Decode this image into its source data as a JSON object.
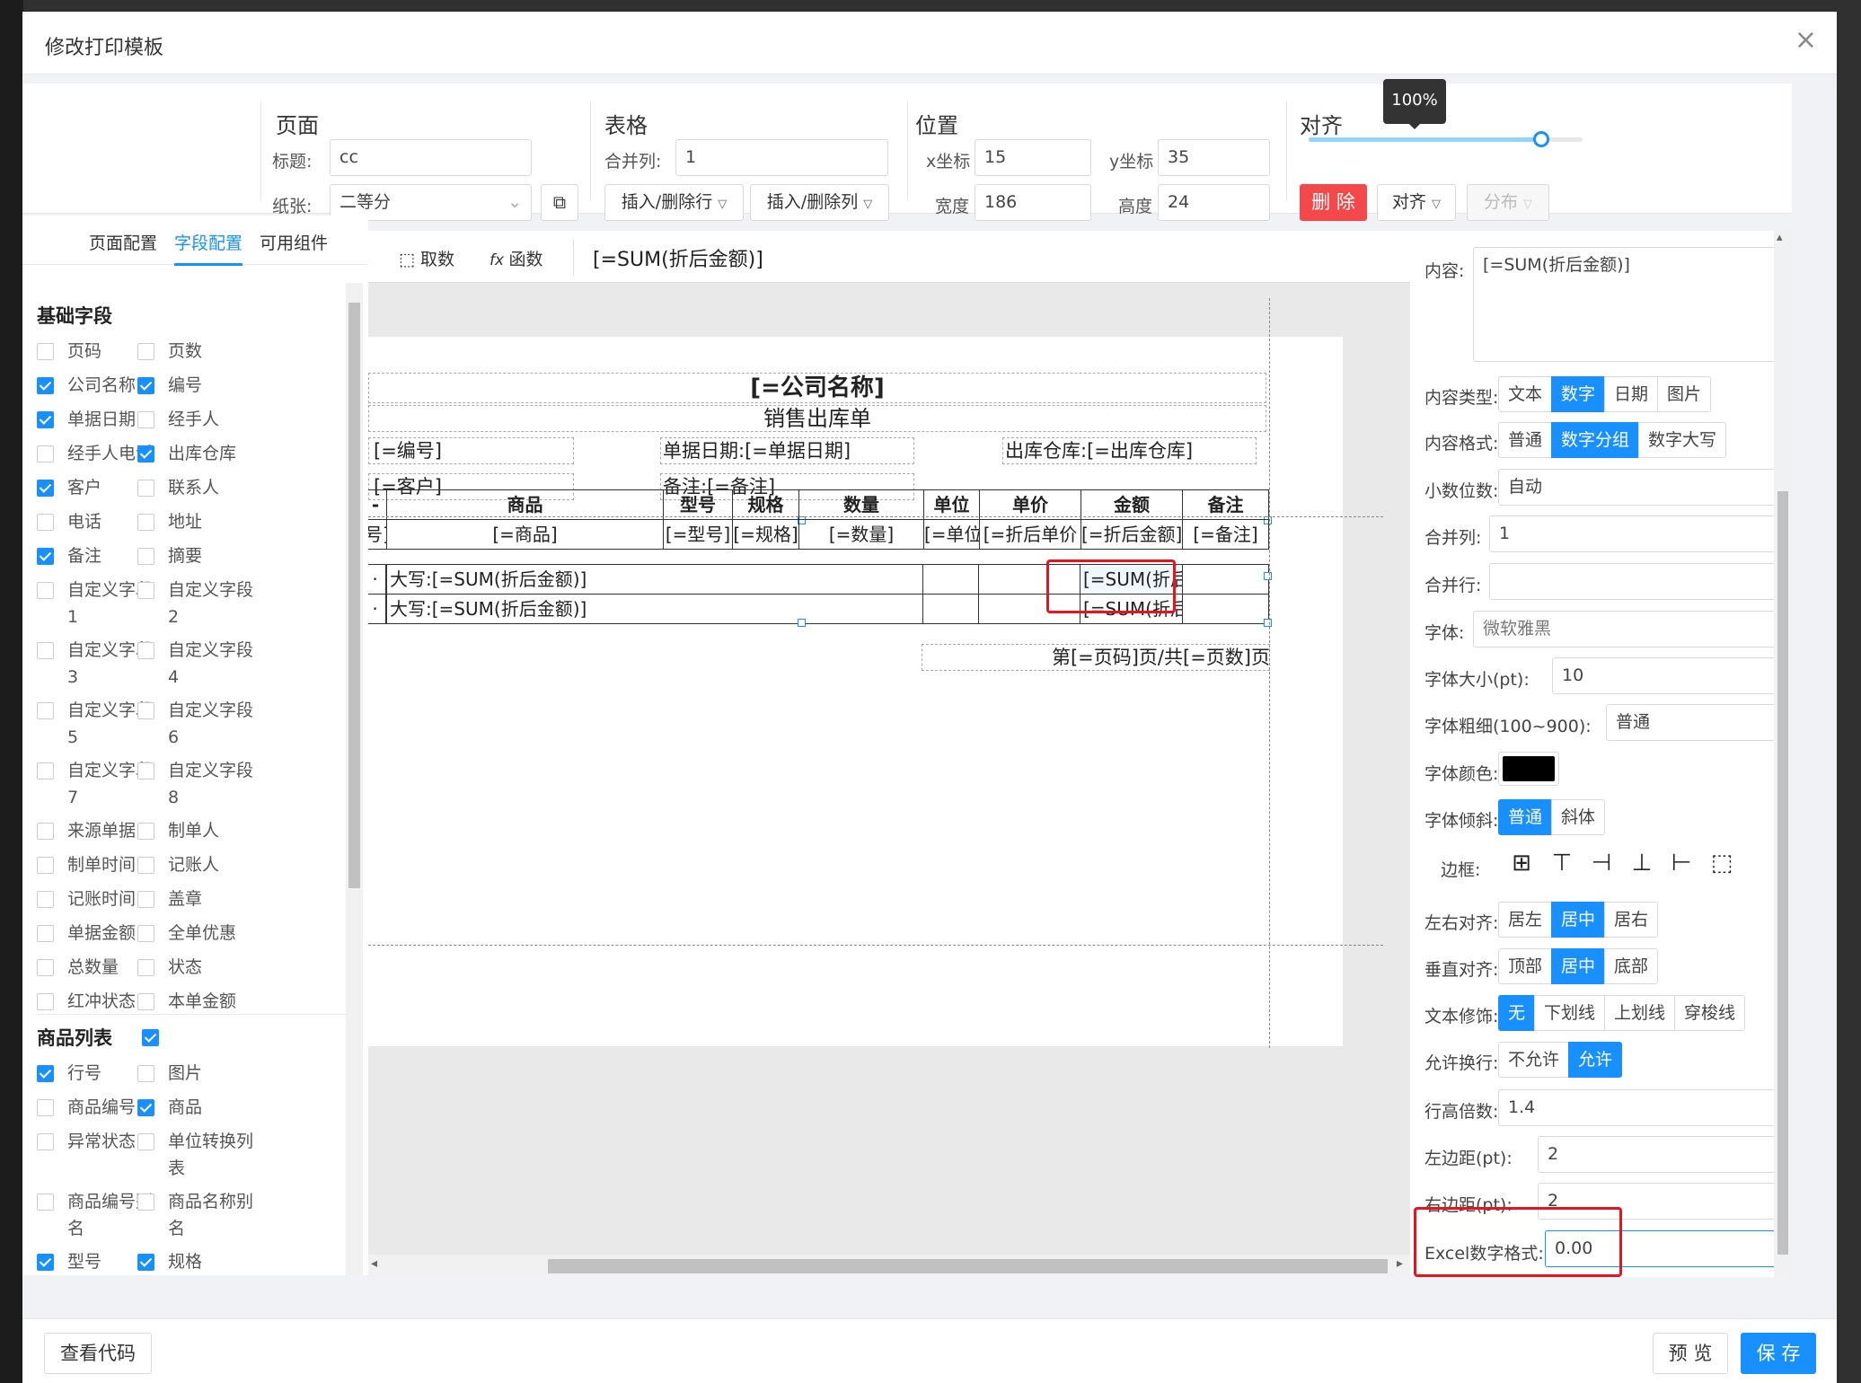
{
  "dialog": {
    "title": "修改打印模板",
    "close": "×",
    "footer": {
      "view_code": "查看代码",
      "preview": "预 览",
      "save": "保 存"
    }
  },
  "toolbar": {
    "page": {
      "title": "页面",
      "title_label": "标题:",
      "title_value": "cc",
      "paper_label": "纸张:",
      "paper_value": "二等分"
    },
    "table": {
      "title": "表格",
      "merge_col_label": "合并列:",
      "merge_col_value": "1",
      "row_btn": "插入/删除行",
      "col_btn": "插入/删除列"
    },
    "position": {
      "title": "位置",
      "x_label": "x坐标",
      "x_value": "15",
      "y_label": "y坐标",
      "y_value": "35",
      "w_label": "宽度",
      "w_value": "186",
      "h_label": "高度",
      "h_value": "24"
    },
    "align": {
      "title": "对齐",
      "zoom": "100%",
      "zoom_level": 0.85,
      "delete": "删 除",
      "align_btn": "对齐",
      "distribute_btn": "分布"
    }
  },
  "left": {
    "tabs": [
      "页面配置",
      "字段配置",
      "可用组件"
    ],
    "active_tab": 1,
    "basic_title": "基础字段",
    "basic_fields": [
      {
        "label": "页码",
        "checked": false
      },
      {
        "label": "页数",
        "checked": false
      },
      {
        "label": "公司名称",
        "checked": true
      },
      {
        "label": "编号",
        "checked": true
      },
      {
        "label": "单据日期",
        "checked": true
      },
      {
        "label": "经手人",
        "checked": false
      },
      {
        "label": "经手人电话",
        "checked": false
      },
      {
        "label": "出库仓库",
        "checked": true
      },
      {
        "label": "客户",
        "checked": true
      },
      {
        "label": "联系人",
        "checked": false
      },
      {
        "label": "电话",
        "checked": false
      },
      {
        "label": "地址",
        "checked": false
      },
      {
        "label": "备注",
        "checked": true
      },
      {
        "label": "摘要",
        "checked": false
      },
      {
        "label": "自定义字段1",
        "checked": false
      },
      {
        "label": "自定义字段2",
        "checked": false
      },
      {
        "label": "自定义字段3",
        "checked": false
      },
      {
        "label": "自定义字段4",
        "checked": false
      },
      {
        "label": "自定义字段5",
        "checked": false
      },
      {
        "label": "自定义字段6",
        "checked": false
      },
      {
        "label": "自定义字段7",
        "checked": false
      },
      {
        "label": "自定义字段8",
        "checked": false
      },
      {
        "label": "来源单据",
        "checked": false
      },
      {
        "label": "制单人",
        "checked": false
      },
      {
        "label": "制单时间",
        "checked": false
      },
      {
        "label": "记账人",
        "checked": false
      },
      {
        "label": "记账时间",
        "checked": false
      },
      {
        "label": "盖章",
        "checked": false
      },
      {
        "label": "单据金额",
        "checked": false
      },
      {
        "label": "全单优惠",
        "checked": false
      },
      {
        "label": "总数量",
        "checked": false
      },
      {
        "label": "状态",
        "checked": false
      },
      {
        "label": "红冲状态",
        "checked": false
      },
      {
        "label": "本单金额",
        "checked": false
      }
    ],
    "goods_title": "商品列表",
    "goods_checked": true,
    "goods_fields": [
      {
        "label": "行号",
        "checked": true
      },
      {
        "label": "图片",
        "checked": false
      },
      {
        "label": "商品编号",
        "checked": false
      },
      {
        "label": "商品",
        "checked": true
      },
      {
        "label": "异常状态",
        "checked": false
      },
      {
        "label": "单位转换列表",
        "checked": false
      },
      {
        "label": "商品编号别名",
        "checked": false
      },
      {
        "label": "商品名称别名",
        "checked": false
      },
      {
        "label": "型号",
        "checked": true
      },
      {
        "label": "规格",
        "checked": true
      }
    ]
  },
  "center": {
    "fetch_btn": "取数",
    "func_btn": "函数",
    "formula": "[=SUM(折后金额)]",
    "company": "[=公司名称]",
    "doc_title": "销售出库单",
    "f_code": "[=编号]",
    "f_date": "单据日期:[=单据日期]",
    "f_wh": "出库仓库:[=出库仓库]",
    "f_cust": "[=客户]",
    "f_note": "备注:[=备注]",
    "headers": [
      "-",
      "商品",
      "型号",
      "规格",
      "数量",
      "单位",
      "单价",
      "金额",
      "备注"
    ],
    "row1": [
      "号]",
      "[=商品]",
      "[=型号]",
      "[=规格]",
      "[=数量]",
      "[=单位",
      "[=折后单价",
      "[=折后金额]",
      "[=备注]"
    ],
    "sum_label": "大写:[=SUM(折后金额)]",
    "sum_value": "[=SUM(折后",
    "page_footer": "第[=页码]页/共[=页数]页"
  },
  "right": {
    "content_label": "内容:",
    "content_value": "[=SUM(折后金额)]",
    "type_label": "内容类型:",
    "type_opts": [
      "文本",
      "数字",
      "日期",
      "图片"
    ],
    "type_active": 1,
    "format_label": "内容格式:",
    "format_opts": [
      "普通",
      "数字分组",
      "数字大写"
    ],
    "format_active": 1,
    "decimal_label": "小数位数:",
    "decimal_value": "自动",
    "merge_col_label": "合并列:",
    "merge_col_value": "1",
    "merge_row_label": "合并行:",
    "merge_row_value": "",
    "font_label": "字体:",
    "font_value": "微软雅黑",
    "size_label": "字体大小(pt):",
    "size_value": "10",
    "weight_label": "字体粗细(100~900):",
    "weight_value": "普通",
    "color_label": "字体颜色:",
    "color_value": "#000000",
    "italic_label": "字体倾斜:",
    "italic_opts": [
      "普通",
      "斜体"
    ],
    "italic_active": 0,
    "border_label": "边框:",
    "halign_label": "左右对齐:",
    "halign_opts": [
      "居左",
      "居中",
      "居右"
    ],
    "halign_active": 1,
    "valign_label": "垂直对齐:",
    "valign_opts": [
      "顶部",
      "居中",
      "底部"
    ],
    "valign_active": 1,
    "deco_label": "文本修饰:",
    "deco_opts": [
      "无",
      "下划线",
      "上划线",
      "穿梭线"
    ],
    "deco_active": 0,
    "wrap_label": "允许换行:",
    "wrap_opts": [
      "不允许",
      "允许"
    ],
    "wrap_active": 1,
    "lh_label": "行高倍数:",
    "lh_value": "1.4",
    "lpad_label": "左边距(pt):",
    "lpad_value": "2",
    "rpad_label": "右边距(pt):",
    "rpad_value": "2",
    "excel_label": "Excel数字格式:",
    "excel_value": "0.00"
  },
  "colors": {
    "accent": "#1890ff",
    "danger": "#f5484b",
    "highlight": "#e8141c"
  }
}
